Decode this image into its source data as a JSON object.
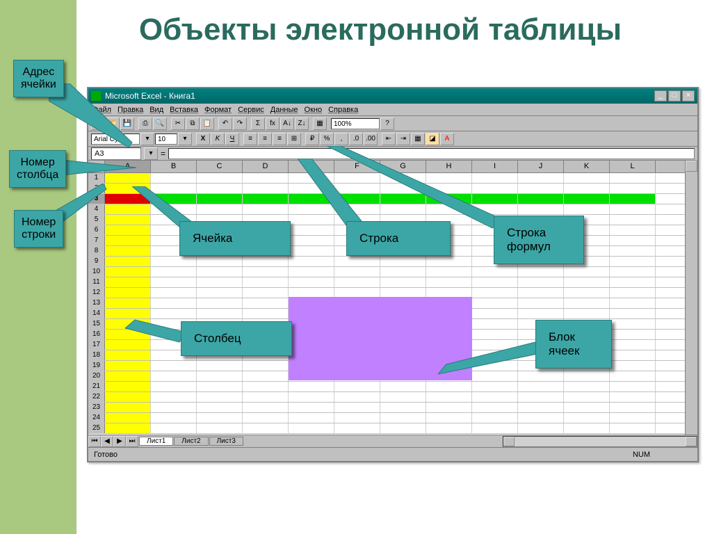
{
  "title": "Объекты электронной таблицы",
  "callouts": {
    "cell_address": "Адрес\nячейки",
    "column_number": "Номер\nстолбца",
    "row_number": "Номер\nстроки"
  },
  "labels": {
    "cell": "Ячейка",
    "row": "Строка",
    "formula_bar": "Строка\nформул",
    "column": "Столбец",
    "cell_block": "Блок\nячеек"
  },
  "excel": {
    "title": "Microsoft Excel - Книга1",
    "menu": [
      "Файл",
      "Правка",
      "Вид",
      "Вставка",
      "Формат",
      "Сервис",
      "Данные",
      "Окно",
      "Справка"
    ],
    "font": "Arial Cyr",
    "font_size": "10",
    "namebox": "A3",
    "zoom": "100%",
    "columns": [
      "A",
      "B",
      "C",
      "D",
      "E",
      "F",
      "G",
      "H",
      "I",
      "J",
      "K",
      "L"
    ],
    "row_count": 25,
    "highlighted_row": 3,
    "sheets": [
      "Лист1",
      "Лист2",
      "Лист3"
    ],
    "status": "Готово",
    "num_indicator": "NUM"
  }
}
